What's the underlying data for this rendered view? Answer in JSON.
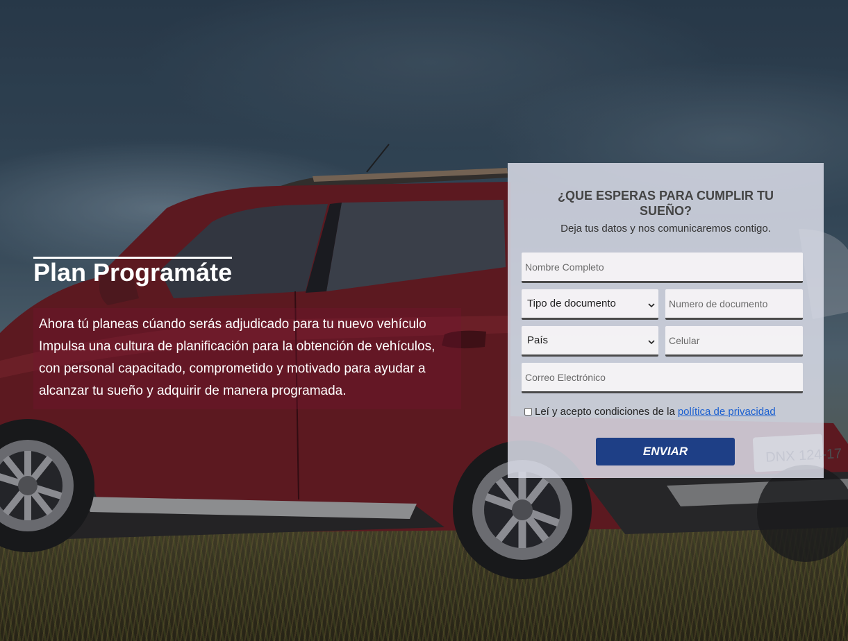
{
  "hero": {
    "title": "Plan Programáte",
    "lines": [
      "Ahora tú planeas cúando serás adjudicado para tu nuevo vehículo",
      "Impulsa una cultura de planificación para la obtención de vehículos, con personal capacitado, comprometido y motivado para ayudar a alcanzar tu sueño y adquirir de manera programada."
    ]
  },
  "background": {
    "vehicle_plate": "DNX 124-17"
  },
  "form": {
    "title": "¿QUE ESPERAS PARA CUMPLIR TU SUEÑO?",
    "subtitle": "Deja tus datos y nos comunicaremos contigo.",
    "name_placeholder": "Nombre Completo",
    "doc_type_selected": "Tipo de documento",
    "doc_number_placeholder": "Numero de documento",
    "country_selected": "País",
    "cell_placeholder": "Celular",
    "email_placeholder": "Correo Electrónico",
    "consent_text": "Leí y acepto condiciones de la",
    "consent_link": "política de privacidad",
    "submit_label": "ENVIAR",
    "submit_color": "#1e3f86"
  }
}
